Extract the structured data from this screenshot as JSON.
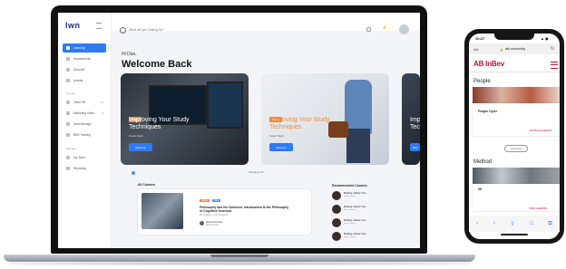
{
  "laptop": {
    "logo": "lwn",
    "search_placeholder": "What are you looking for?",
    "sidebar": {
      "items": [
        {
          "label": "Learning",
          "active": true
        },
        {
          "label": "Assessments"
        },
        {
          "label": "Discover"
        },
        {
          "label": "Activity"
        }
      ],
      "section1": "Groups",
      "groups": [
        {
          "label": "Team HR",
          "badge": "12"
        },
        {
          "label": "Marketing Sales",
          "badge": "8"
        },
        {
          "label": "Data Manage...",
          "badge": ""
        },
        {
          "label": "BDR Training",
          "badge": ""
        }
      ],
      "section2": "Manage",
      "manage": [
        {
          "label": "My Team"
        },
        {
          "label": "Reporting"
        }
      ]
    },
    "greeting": "Hi Dan,",
    "welcome": "Welcome Back",
    "cards": [
      {
        "tag": "Article",
        "title": "Improving Your Study Techniques",
        "author": "Susan Taylor",
        "button": "Resume"
      },
      {
        "tag": "Article",
        "title": "Improving Your Study Techniques",
        "author": "Susan Taylor",
        "button": "Resume"
      },
      {
        "title": "Imp Tech",
        "button": "Res"
      }
    ],
    "carousel_label": "Showing 1/3",
    "all_courses": "All Courses",
    "course": {
      "tag1": "Article",
      "tag2": "New",
      "title": "Philosophy and the Sciences: Introduction to the Philosophy of Cognitive Sciences",
      "meta": "4h Duration • 234 Students",
      "author": "Daniel Donovan",
      "author_role": "Senior Expert"
    },
    "recommended": "Recommended Courses",
    "rec_items": [
      {
        "title": "Building a Better Tea...",
        "meta": "Senior Expert"
      },
      {
        "title": "Building a Better Tea...",
        "meta": "Senior Expert"
      },
      {
        "title": "Building a Better Tea...",
        "meta": "Senior Expert"
      },
      {
        "title": "Building a Better Tea...",
        "meta": "Senior Expert"
      }
    ]
  },
  "phone": {
    "time": "10:27",
    "status": "▲ ◼",
    "aa": "AA",
    "url": "abi.university",
    "brand": "AB InBev",
    "people": "People",
    "cycle": "People Cycle",
    "link1": "CONTINUE LEARNING",
    "button": "Load more",
    "method": "Method",
    "num": "6S",
    "link2": "START LEARNING",
    "nav": [
      "‹",
      "›",
      "⇪",
      "□",
      "⧉"
    ]
  },
  "colors": {
    "accent": "#2f7af5",
    "brand_red": "#c8102e",
    "tag_orange": "#f08a3c"
  }
}
